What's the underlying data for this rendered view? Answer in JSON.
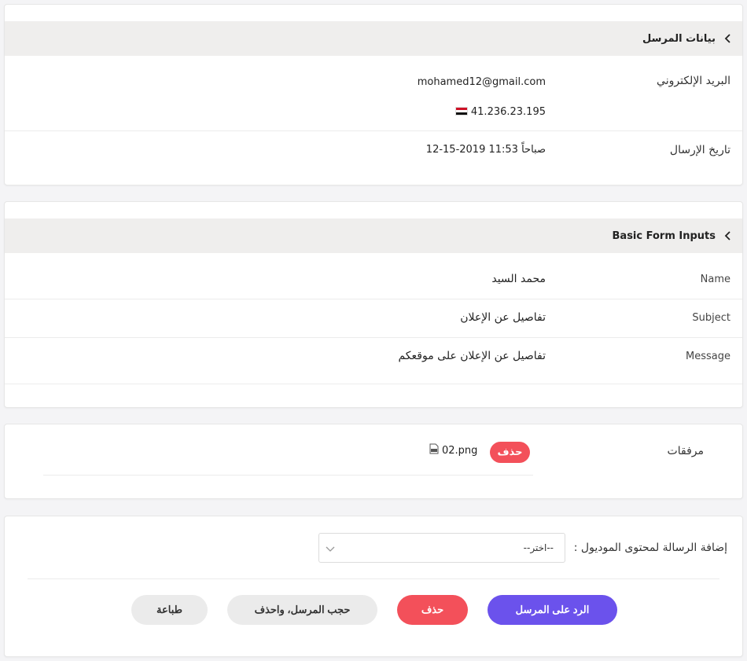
{
  "sender_card": {
    "title": "بيانات المرسل",
    "email_label": "البريد الإلكتروني",
    "email_value": "mohamed12@gmail.com",
    "ip_value": "41.236.23.195",
    "flag_icon": "egypt-flag-icon",
    "date_label": "تاريخ الإرسال",
    "date_value": "12-15-2019 11:53 صباحاً"
  },
  "form_card": {
    "title": "Basic Form Inputs",
    "rows": [
      {
        "label": "Name",
        "value": "محمد السيد"
      },
      {
        "label": "Subject",
        "value": "تفاصيل عن الإعلان"
      },
      {
        "label": "Message",
        "value": "تفاصيل عن الإعلان على موقعكم"
      }
    ]
  },
  "attachments_card": {
    "label": "مرفقات",
    "file_name": "02.png",
    "file_icon": "png-file-icon",
    "delete_label": "حذف"
  },
  "actions_card": {
    "module_label": "إضافة الرسالة لمحتوى الموديول :",
    "select_value": "--اختر--",
    "reply_label": "الرد على المرسل",
    "delete_label": "حذف",
    "block_delete_label": "حجب المرسل، واحذف",
    "print_label": "طباعة"
  },
  "colors": {
    "primary": "#6b52ec",
    "danger": "#f3505a",
    "header_bg": "#efeeed"
  }
}
